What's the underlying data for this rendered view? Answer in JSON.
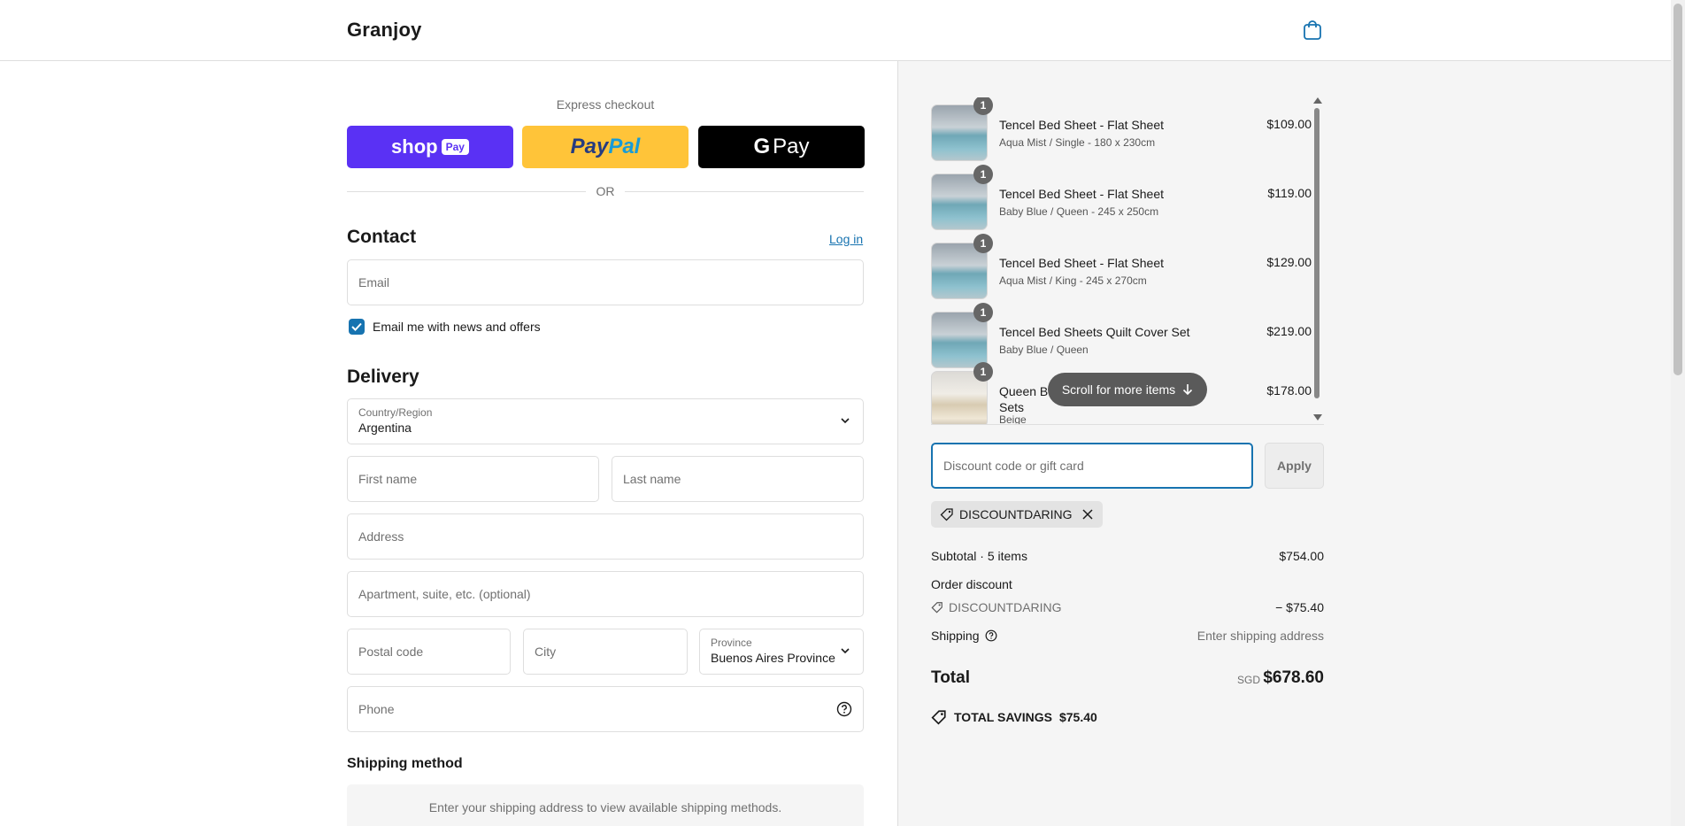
{
  "header": {
    "brand": "Granjoy",
    "cart_icon": "shopping-bag-icon"
  },
  "express": {
    "label": "Express checkout",
    "shoppay": {
      "text": "shop",
      "badge": "Pay"
    },
    "paypal": {
      "part1": "Pay",
      "part2": "Pal"
    },
    "gpay": {
      "g": "G",
      "text": "Pay"
    },
    "or": "OR"
  },
  "contact": {
    "title": "Contact",
    "login": "Log in",
    "email_placeholder": "Email",
    "newsletter_label": "Email me with news and offers",
    "newsletter_checked": true
  },
  "delivery": {
    "title": "Delivery",
    "country_label": "Country/Region",
    "country_value": "Argentina",
    "first_name": "First name",
    "last_name": "Last name",
    "address": "Address",
    "apartment": "Apartment, suite, etc. (optional)",
    "postal": "Postal code",
    "city": "City",
    "province_label": "Province",
    "province_value": "Buenos Aires Province",
    "phone": "Phone"
  },
  "shipping": {
    "title": "Shipping method",
    "message": "Enter your shipping address to view available shipping methods."
  },
  "cart": {
    "items": [
      {
        "qty": "1",
        "name": "Tencel Bed Sheet - Flat Sheet",
        "variant": "Aqua Mist / Single - 180 x 230cm",
        "price": "$109.00"
      },
      {
        "qty": "1",
        "name": "Tencel Bed Sheet - Flat Sheet",
        "variant": "Baby Blue / Queen - 245 x 250cm",
        "price": "$119.00"
      },
      {
        "qty": "1",
        "name": "Tencel Bed Sheet - Flat Sheet",
        "variant": "Aqua Mist / King - 245 x 270cm",
        "price": "$129.00"
      },
      {
        "qty": "1",
        "name": "Tencel Bed Sheets Quilt Cover Set",
        "variant": "Baby Blue / Queen",
        "price": "$219.00"
      },
      {
        "qty": "1",
        "name": "Queen Bed Quilt Cover Set - Bedding Sets",
        "variant": "Beige",
        "price": "$178.00"
      }
    ],
    "scroll_hint": "Scroll for more items"
  },
  "discount": {
    "placeholder": "Discount code or gift card",
    "apply": "Apply",
    "applied_code": "DISCOUNTDARING"
  },
  "summary": {
    "subtotal_label": "Subtotal · 5 items",
    "subtotal_value": "$754.00",
    "order_discount_label": "Order discount",
    "discount_code": "DISCOUNTDARING",
    "discount_value": "− $75.40",
    "shipping_label": "Shipping",
    "shipping_value": "Enter shipping address",
    "total_label": "Total",
    "currency": "SGD",
    "total_value": "$678.60",
    "savings_label": "TOTAL SAVINGS",
    "savings_value": "$75.40"
  },
  "colors": {
    "accent": "#1773b0",
    "shoppay": "#5a31f4",
    "paypal": "#ffc439"
  }
}
